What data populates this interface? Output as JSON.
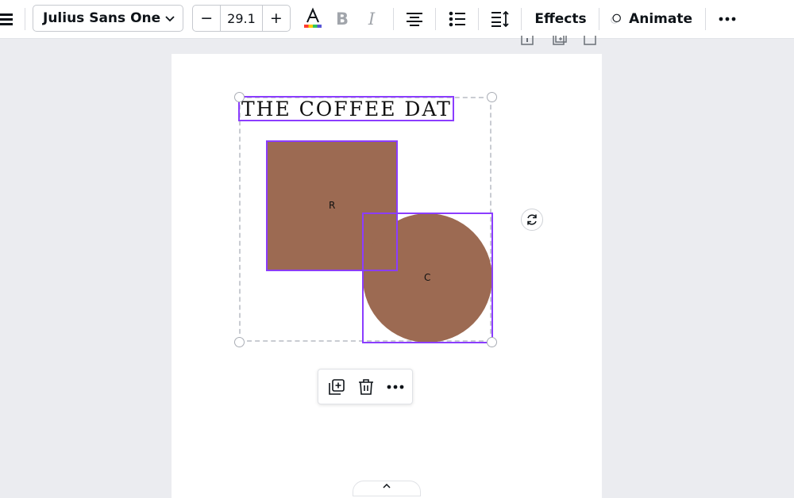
{
  "toolbar": {
    "font_family_value": "Julius Sans One",
    "font_size_value": "29.1",
    "decrease_label": "−",
    "increase_label": "+",
    "bold_label": "B",
    "italic_label": "I",
    "effects_label": "Effects",
    "animate_label": "Animate"
  },
  "canvas": {
    "title_text": "THE COFFEE DATE- T",
    "square_label": "R",
    "circle_label": "C"
  },
  "colors": {
    "selection": "#8b3dff",
    "shape_fill": "#9c6a52"
  },
  "icons": {
    "menu": "hamburger-icon",
    "chevron": "chevron-down-icon",
    "text_color": "text-color-icon",
    "align": "align-center-icon",
    "list": "list-icon",
    "spacing": "line-spacing-icon",
    "animate": "animate-icon",
    "more": "more-icon",
    "rotate": "rotate-icon",
    "duplicate": "duplicate-icon",
    "delete": "trash-icon"
  }
}
